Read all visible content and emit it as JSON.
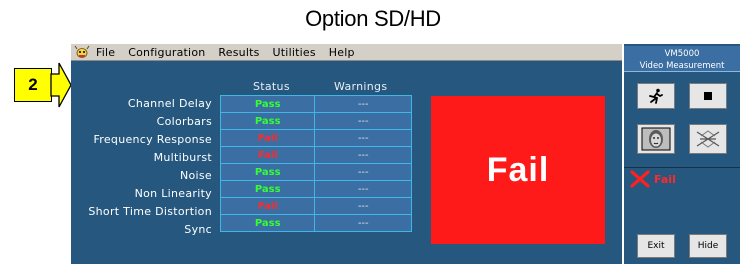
{
  "caption": "Option SD/HD",
  "callout": {
    "number": "2"
  },
  "menu": {
    "items": [
      "File",
      "Configuration",
      "Results",
      "Utilities",
      "Help"
    ]
  },
  "table": {
    "headers": {
      "status": "Status",
      "warnings": "Warnings"
    },
    "rows": [
      {
        "label": "Channel Delay",
        "status": "Pass",
        "warning": "---"
      },
      {
        "label": "Colorbars",
        "status": "Pass",
        "warning": "---"
      },
      {
        "label": "Frequency Response",
        "status": "Fail",
        "warning": "---"
      },
      {
        "label": "Multiburst",
        "status": "Fail",
        "warning": "---"
      },
      {
        "label": "Noise",
        "status": "Pass",
        "warning": "---"
      },
      {
        "label": "Non Linearity",
        "status": "Pass",
        "warning": "---"
      },
      {
        "label": "Short Time Distortion",
        "status": "Fail",
        "warning": "---"
      },
      {
        "label": "Sync",
        "status": "Pass",
        "warning": "---"
      }
    ]
  },
  "result": {
    "overall": "Fail",
    "color": "#ff1a1a"
  },
  "panel": {
    "title_line1": "VM5000",
    "title_line2": "Video Measurement",
    "status_text": "Fail",
    "exit_label": "Exit",
    "hide_label": "Hide"
  },
  "colors": {
    "pass": "#34ff34",
    "fail": "#ff2a2a",
    "window_bg": "#25577f",
    "cell_bg": "#3b6ea2",
    "cell_border": "#3fb6e4"
  }
}
